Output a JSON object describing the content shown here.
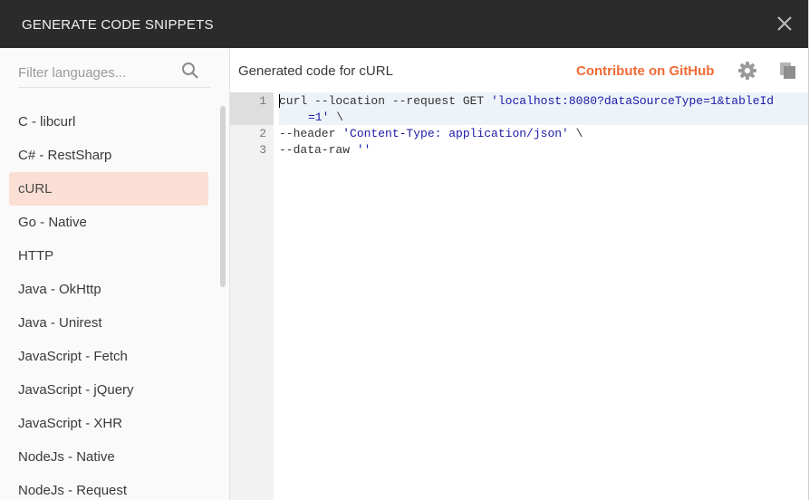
{
  "dialog": {
    "title": "GENERATE CODE SNIPPETS"
  },
  "search": {
    "placeholder": "Filter languages..."
  },
  "languages": [
    "C - libcurl",
    "C# - RestSharp",
    "cURL",
    "Go - Native",
    "HTTP",
    "Java - OkHttp",
    "Java - Unirest",
    "JavaScript - Fetch",
    "JavaScript - jQuery",
    "JavaScript - XHR",
    "NodeJs - Native",
    "NodeJs - Request"
  ],
  "selected_language": "cURL",
  "main": {
    "title": "Generated code for cURL",
    "github_link": "Contribute on GitHub"
  },
  "code": {
    "line_numbers": [
      "1",
      "2",
      "3"
    ],
    "line1_plain": "curl --location --request GET ",
    "line1_string": "'localhost:8080?dataSourceType=1&tableId",
    "line1_wrap_string": "=1'",
    "line1_wrap_tail": " \\",
    "line2_plain": "--header ",
    "line2_string": "'Content-Type: application/json'",
    "line2_tail": " \\",
    "line3_plain": "--data-raw ",
    "line3_string": "''"
  },
  "colors": {
    "header_bg": "#2b2b2b",
    "accent": "#f06a35",
    "selected_bg": "#fbdfd5",
    "string": "#1a1aa6"
  },
  "icons": {
    "close": "close-icon",
    "search": "search-icon",
    "settings": "gear-icon",
    "copy": "copy-icon"
  }
}
